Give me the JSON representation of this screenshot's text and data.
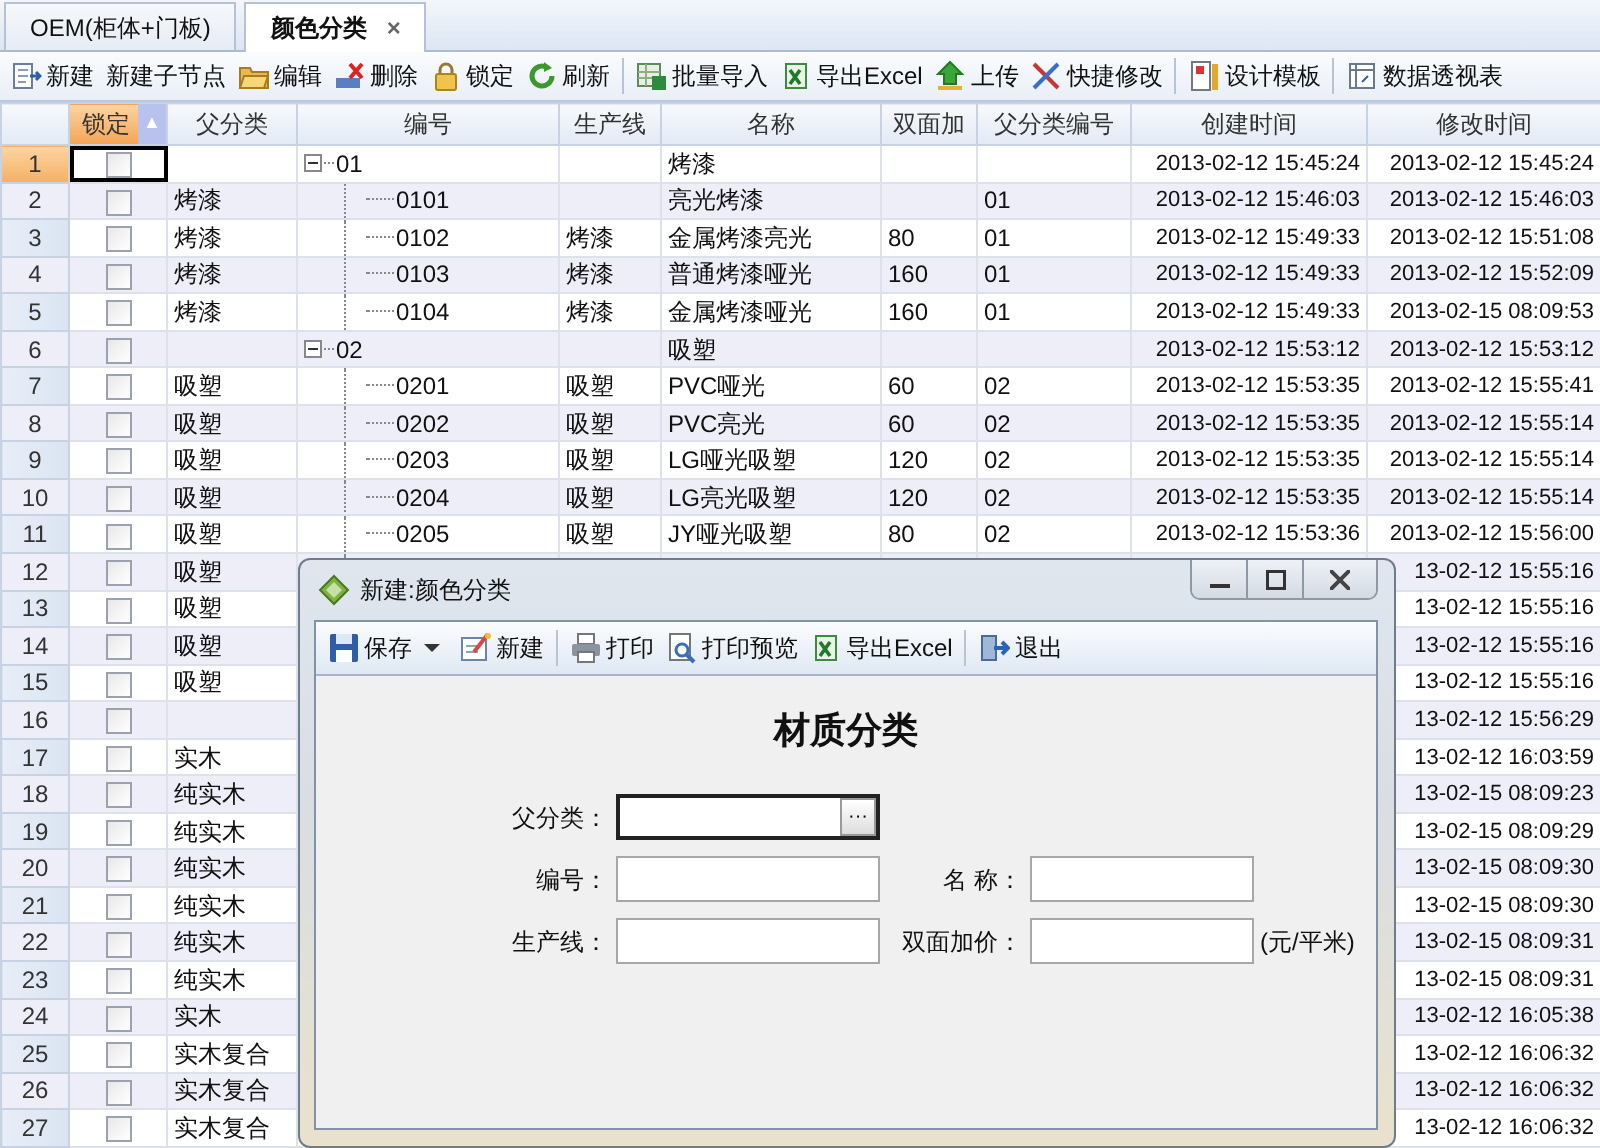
{
  "tabs": [
    {
      "label": "OEM(柜体+门板)",
      "selected": false
    },
    {
      "label": "颜色分类",
      "selected": true,
      "close": "×"
    }
  ],
  "toolbar": [
    {
      "kind": "button",
      "label": "新建"
    },
    {
      "kind": "button",
      "label": "新建子节点"
    },
    {
      "kind": "button",
      "label": "编辑"
    },
    {
      "kind": "button",
      "label": "删除"
    },
    {
      "kind": "button",
      "label": "锁定"
    },
    {
      "kind": "button",
      "label": "刷新"
    },
    {
      "kind": "separator"
    },
    {
      "kind": "button",
      "label": "批量导入"
    },
    {
      "kind": "button",
      "label": "导出Excel"
    },
    {
      "kind": "button",
      "label": "上传"
    },
    {
      "kind": "button",
      "label": "快捷修改"
    },
    {
      "kind": "separator"
    },
    {
      "kind": "button",
      "label": "设计模板"
    },
    {
      "kind": "separator"
    },
    {
      "kind": "button",
      "label": "数据透视表"
    }
  ],
  "table": {
    "columns": [
      {
        "label": "锁定",
        "sorted": true,
        "sort_mark": "▲"
      },
      {
        "label": "父分类",
        "sorted": false
      },
      {
        "label": "编号",
        "sorted": false
      },
      {
        "label": "生产线",
        "sorted": false
      },
      {
        "label": "名称",
        "sorted": false
      },
      {
        "label": "双面加",
        "sorted": false
      },
      {
        "label": "父分类编号",
        "sorted": false
      },
      {
        "label": "创建时间",
        "sorted": false
      },
      {
        "label": "修改时间",
        "sorted": false
      }
    ],
    "rows": [
      {
        "num": "1",
        "locked": false,
        "selected": true,
        "code": "01",
        "name": "烤漆",
        "created": "2013-02-12 15:45:24",
        "modified": "2013-02-12 15:45:24",
        "expanded": true,
        "children": [
          {
            "num": "2",
            "locked": false,
            "selected": false,
            "parent": "烤漆",
            "code": "0101",
            "name": "亮光烤漆",
            "parent_code": "01",
            "created": "2013-02-12 15:46:03",
            "modified": "2013-02-12 15:46:03"
          },
          {
            "num": "3",
            "locked": false,
            "selected": false,
            "parent": "烤漆",
            "code": "0102",
            "line": "烤漆",
            "name": "金属烤漆亮光",
            "double": "80",
            "parent_code": "01",
            "created": "2013-02-12 15:49:33",
            "modified": "2013-02-12 15:51:08"
          },
          {
            "num": "4",
            "locked": false,
            "selected": false,
            "parent": "烤漆",
            "code": "0103",
            "line": "烤漆",
            "name": "普通烤漆哑光",
            "double": "160",
            "parent_code": "01",
            "created": "2013-02-12 15:49:33",
            "modified": "2013-02-12 15:52:09"
          },
          {
            "num": "5",
            "locked": false,
            "selected": false,
            "parent": "烤漆",
            "code": "0104",
            "line": "烤漆",
            "name": "金属烤漆哑光",
            "double": "160",
            "parent_code": "01",
            "created": "2013-02-12 15:49:33",
            "modified": "2013-02-15 08:09:53"
          }
        ]
      },
      {
        "num": "6",
        "locked": false,
        "selected": false,
        "code": "02",
        "name": "吸塑",
        "created": "2013-02-12 15:53:12",
        "modified": "2013-02-12 15:53:12",
        "expanded": true,
        "children": [
          {
            "num": "7",
            "locked": false,
            "selected": false,
            "parent": "吸塑",
            "code": "0201",
            "line": "吸塑",
            "name": "PVC哑光",
            "double": "60",
            "parent_code": "02",
            "created": "2013-02-12 15:53:35",
            "modified": "2013-02-12 15:55:41"
          },
          {
            "num": "8",
            "locked": false,
            "selected": false,
            "parent": "吸塑",
            "code": "0202",
            "line": "吸塑",
            "name": "PVC亮光",
            "double": "60",
            "parent_code": "02",
            "created": "2013-02-12 15:53:35",
            "modified": "2013-02-12 15:55:14"
          },
          {
            "num": "9",
            "locked": false,
            "selected": false,
            "parent": "吸塑",
            "code": "0203",
            "line": "吸塑",
            "name": "LG哑光吸塑",
            "double": "120",
            "parent_code": "02",
            "created": "2013-02-12 15:53:35",
            "modified": "2013-02-12 15:55:14"
          },
          {
            "num": "10",
            "locked": false,
            "selected": false,
            "parent": "吸塑",
            "code": "0204",
            "line": "吸塑",
            "name": "LG亮光吸塑",
            "double": "120",
            "parent_code": "02",
            "created": "2013-02-12 15:53:35",
            "modified": "2013-02-12 15:55:14"
          },
          {
            "num": "11",
            "locked": false,
            "selected": false,
            "parent": "吸塑",
            "code": "0205",
            "line": "吸塑",
            "name": "JY哑光吸塑",
            "double": "80",
            "parent_code": "02",
            "created": "2013-02-12 15:53:36",
            "modified": "2013-02-12 15:56:00"
          },
          {
            "num": "12",
            "locked": false,
            "selected": false,
            "parent": "吸塑",
            "modified": "13-02-12 15:55:16"
          },
          {
            "num": "13",
            "locked": false,
            "selected": false,
            "parent": "吸塑",
            "modified": "13-02-12 15:55:16"
          },
          {
            "num": "14",
            "locked": false,
            "selected": false,
            "parent": "吸塑",
            "modified": "13-02-12 15:55:16"
          },
          {
            "num": "15",
            "locked": false,
            "selected": false,
            "parent": "吸塑",
            "modified": "13-02-12 15:55:16"
          }
        ]
      },
      {
        "num": "16",
        "locked": false,
        "selected": false,
        "modified": "13-02-12 15:56:29",
        "children": [
          {
            "num": "17",
            "locked": false,
            "selected": false,
            "parent": "实木",
            "modified": "13-02-12 16:03:59",
            "children": [
              {
                "num": "18",
                "locked": false,
                "selected": false,
                "parent": "纯实木",
                "modified": "13-02-15 08:09:23"
              },
              {
                "num": "19",
                "locked": false,
                "selected": false,
                "parent": "纯实木",
                "modified": "13-02-15 08:09:29"
              },
              {
                "num": "20",
                "locked": false,
                "selected": false,
                "parent": "纯实木",
                "modified": "13-02-15 08:09:30"
              },
              {
                "num": "21",
                "locked": false,
                "selected": false,
                "parent": "纯实木",
                "modified": "13-02-15 08:09:30"
              },
              {
                "num": "22",
                "locked": false,
                "selected": false,
                "parent": "纯实木",
                "modified": "13-02-15 08:09:31"
              },
              {
                "num": "23",
                "locked": false,
                "selected": false,
                "parent": "纯实木",
                "modified": "13-02-15 08:09:31"
              }
            ]
          },
          {
            "num": "24",
            "locked": false,
            "selected": false,
            "parent": "实木",
            "modified": "13-02-12 16:05:38",
            "children": [
              {
                "num": "25",
                "locked": false,
                "selected": false,
                "parent": "实木复合",
                "modified": "13-02-12 16:06:32"
              },
              {
                "num": "26",
                "locked": false,
                "selected": false,
                "parent": "实木复合",
                "modified": "13-02-12 16:06:32"
              },
              {
                "num": "27",
                "locked": false,
                "selected": false,
                "parent": "实木复合",
                "modified": "13-02-12 16:06:32"
              }
            ]
          }
        ]
      }
    ]
  },
  "dialog": {
    "title": "新建:颜色分类",
    "toolbar": [
      {
        "kind": "button",
        "label": "保存",
        "dropdown": true
      },
      {
        "kind": "button",
        "label": "新建"
      },
      {
        "kind": "separator"
      },
      {
        "kind": "button",
        "label": "打印"
      },
      {
        "kind": "button",
        "label": "打印预览"
      },
      {
        "kind": "button",
        "label": "导出Excel"
      },
      {
        "kind": "separator"
      },
      {
        "kind": "button",
        "label": "退出"
      }
    ],
    "heading": "材质分类",
    "form": [
      [
        {
          "label": "父分类：",
          "kind": "lookup",
          "focused": true,
          "button": "···"
        }
      ],
      [
        {
          "label": "编号：",
          "kind": "text",
          "focused": false
        },
        {
          "label": "名 称：",
          "kind": "text",
          "focused": false
        }
      ],
      [
        {
          "label": "生产线：",
          "kind": "text",
          "focused": false
        },
        {
          "label": "双面加价：",
          "kind": "text",
          "focused": false,
          "unit": "(元/平米)"
        }
      ]
    ]
  }
}
